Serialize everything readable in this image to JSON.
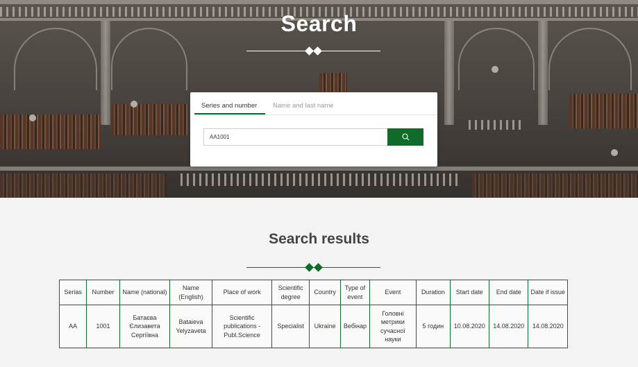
{
  "hero": {
    "title": "Search"
  },
  "search": {
    "tabs": [
      {
        "label": "Series and number",
        "active": true
      },
      {
        "label": "Name and last name",
        "active": false
      }
    ],
    "input_value": "AA1001",
    "button_icon": "search-icon"
  },
  "results": {
    "title": "Search results",
    "columns": [
      "Serias",
      "Number",
      "Name (national)",
      "Name (English)",
      "Place of work",
      "Scientific degree",
      "Country",
      "Type of event",
      "Event",
      "Duration",
      "Start date",
      "End date",
      "Date if issue"
    ],
    "rows": [
      [
        "AA",
        "1001",
        "Батаєва Єлизавета Сергіївна",
        "Bataieva Yelyzaveta",
        "Scientific publications - Publ.Science",
        "Specialist",
        "Ukraine",
        "Вебінар",
        "Головні метрики сучасної науки",
        "5 годин",
        "10.08.2020",
        "14.08.2020",
        "14.08.2020"
      ]
    ]
  },
  "colors": {
    "accent": "#0e6b2a",
    "divider_light": "#ffffff"
  }
}
